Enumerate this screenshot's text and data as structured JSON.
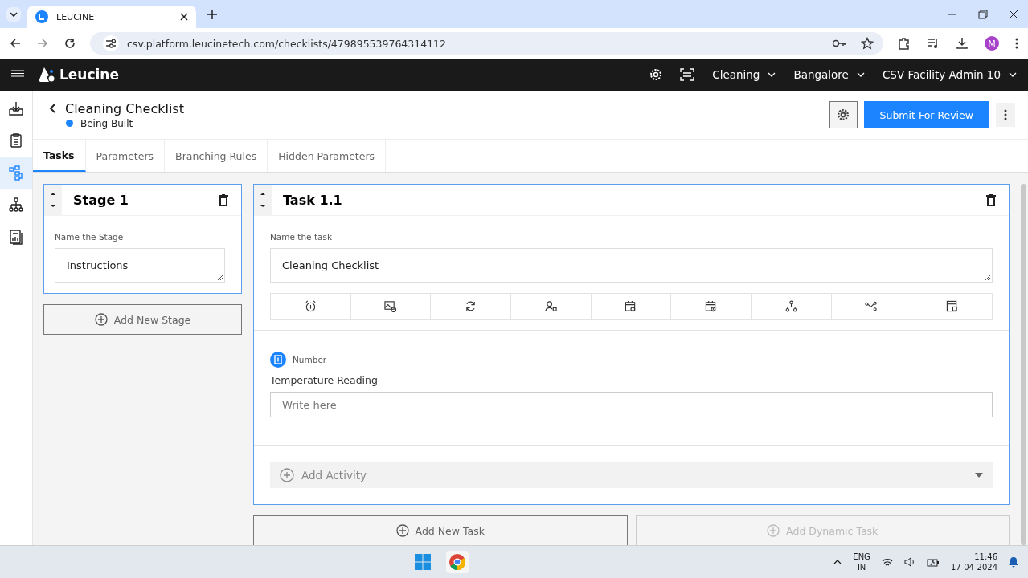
{
  "browser": {
    "tab_title": "LEUCINE",
    "url": "csv.platform.leucinetech.com/checklists/479895539764314112",
    "avatar": "M"
  },
  "app_header": {
    "brand": "Leucine",
    "dropdowns": [
      "Cleaning",
      "Bangalore",
      "CSV Facility Admin 10"
    ]
  },
  "sidebar": {
    "items": [
      {
        "selected": false
      },
      {
        "selected": false
      },
      {
        "selected": true
      },
      {
        "selected": false
      },
      {
        "selected": false
      }
    ]
  },
  "page": {
    "title": "Cleaning Checklist",
    "status": {
      "label": "Being Built",
      "color": "#1d84ff"
    },
    "submit_button": "Submit For Review"
  },
  "tabs": [
    {
      "label": "Tasks",
      "selected": true
    },
    {
      "label": "Parameters",
      "selected": false
    },
    {
      "label": "Branching Rules",
      "selected": false
    },
    {
      "label": "Hidden Parameters",
      "selected": false
    }
  ],
  "stage": {
    "title": "Stage 1",
    "field_label": "Name the Stage",
    "value": "Instructions",
    "add_button": "Add New Stage"
  },
  "task": {
    "title": "Task 1.1",
    "field_label": "Name the task",
    "value": "Cleaning Checklist",
    "parameter": {
      "type": "Number",
      "label": "Temperature Reading",
      "placeholder": "Write here"
    },
    "add_activity": "Add Activity"
  },
  "task_buttons": [
    {
      "label": "Add New Task",
      "disabled": false
    },
    {
      "label": "Add Dynamic Task",
      "disabled": true
    }
  ],
  "taskbar": {
    "language": "ENG",
    "region": "IN",
    "time": "11:46",
    "date": "17-04-2024"
  }
}
